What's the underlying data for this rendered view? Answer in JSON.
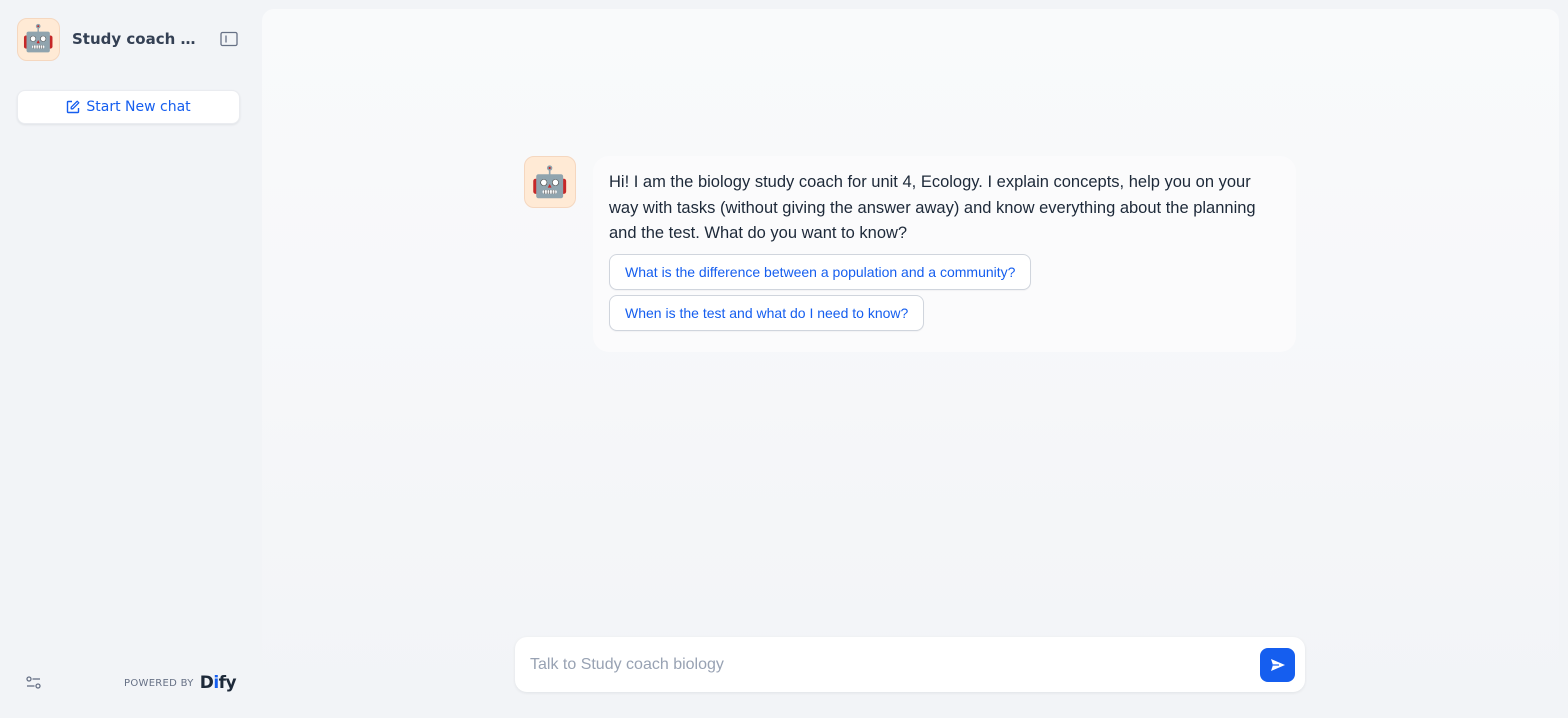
{
  "sidebar": {
    "app_icon": "robot-emoji",
    "app_title": "Study coach biology",
    "collapse_icon": "sidebar-toggle-icon",
    "new_chat_label": "Start New chat",
    "new_chat_icon": "edit-square-icon",
    "settings_icon": "sliders-icon",
    "powered_by_label": "POWERED BY",
    "powered_by_brand_prefix": "D",
    "powered_by_brand_dot": "i",
    "powered_by_brand_suffix": "fy"
  },
  "chat": {
    "bot_avatar_icon": "robot-emoji",
    "opening_message": "Hi! I am the biology study coach for unit 4, Ecology. I explain concepts, help you on your way with tasks (without giving the answer away) and know everything about the planning and the test. What do you want to know?",
    "suggested_questions": [
      "What is the difference between a population and a community?",
      "When is the test and what do I need to know?"
    ]
  },
  "composer": {
    "placeholder": "Talk to Study coach biology",
    "value": "",
    "send_icon": "send-arrow-icon"
  },
  "colors": {
    "accent": "#155EEF",
    "app_icon_bg": "#FFEAD5",
    "page_bg": "#F2F4F7"
  }
}
